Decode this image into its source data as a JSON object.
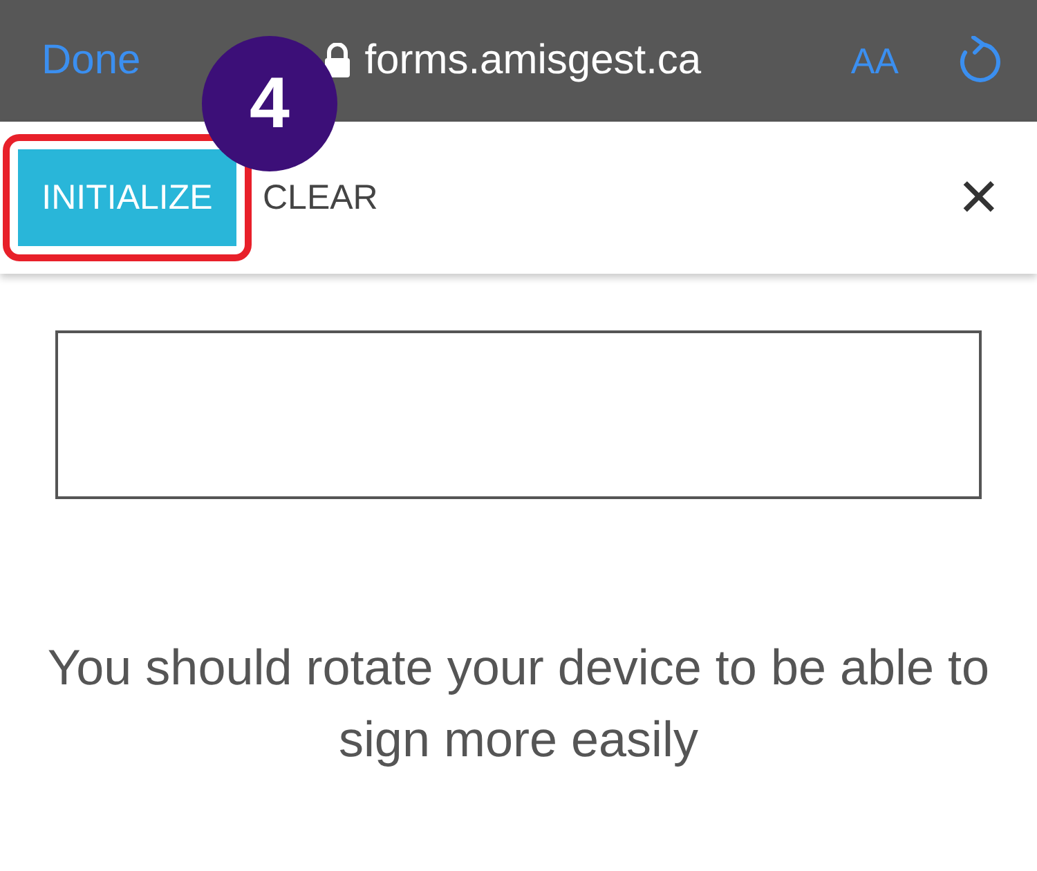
{
  "browser_bar": {
    "done": "Done",
    "url": "forms.amisgest.ca",
    "text_size": "AA"
  },
  "toolbar": {
    "buttons": [
      {
        "label": "INITIALIZE",
        "kind": "primary",
        "highlighted": true
      },
      {
        "label": "CLEAR",
        "kind": "plain",
        "highlighted": false
      }
    ],
    "close": "✕"
  },
  "step_badge": "4",
  "message": "You should rotate your device to be able to sign more easily"
}
